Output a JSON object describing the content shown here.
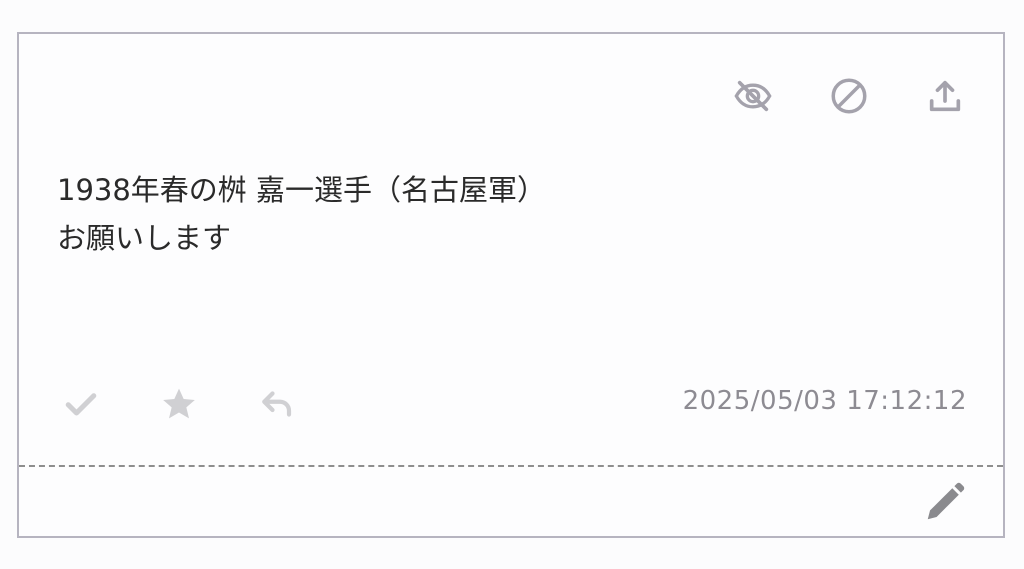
{
  "post": {
    "line1": "1938年春の桝 嘉一選手（名古屋軍）",
    "line2": "お願いします",
    "timestamp": "2025/05/03 17:12:12"
  },
  "icons": {
    "top": [
      "eye-off-icon",
      "block-icon",
      "share-upload-icon"
    ],
    "bottom": [
      "check-icon",
      "star-icon",
      "reply-icon"
    ],
    "footer": "pencil-icon"
  },
  "colors": {
    "icon_top": "#a4a2ac",
    "icon_bottom": "#d0d0d3",
    "icon_edit": "#8a8a8e",
    "text": "#2a2a2a",
    "timestamp": "#8d8b92",
    "border": "#b6b4c0"
  }
}
